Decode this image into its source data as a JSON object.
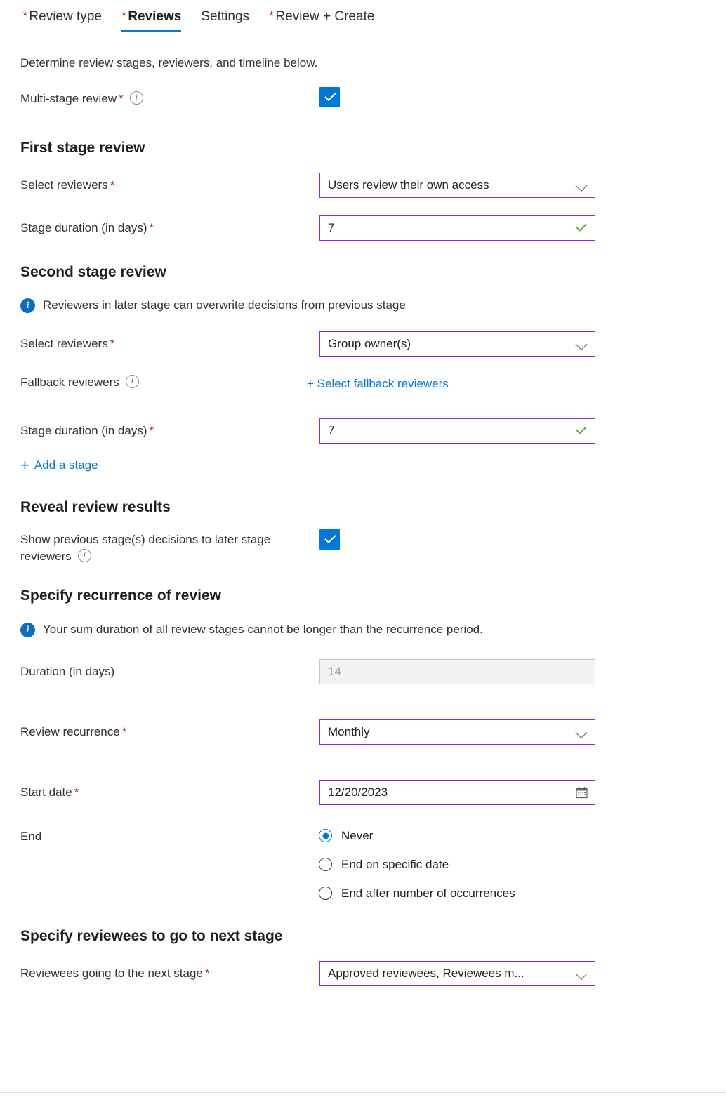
{
  "tabs": [
    {
      "label": "Review type",
      "required": true,
      "active": false
    },
    {
      "label": "Reviews",
      "required": true,
      "active": true
    },
    {
      "label": "Settings",
      "required": false,
      "active": false
    },
    {
      "label": "Review + Create",
      "required": true,
      "active": false
    }
  ],
  "intro": "Determine review stages, reviewers, and timeline below.",
  "multi_stage": {
    "label": "Multi-stage review",
    "required_mark": "*",
    "info_icon": "info-circle-outline-icon",
    "checked": true
  },
  "first_stage": {
    "heading": "First stage review",
    "select_reviewers": {
      "label": "Select reviewers",
      "required_mark": "*",
      "value": "Users review their own access",
      "icon": "chevron-down-icon"
    },
    "stage_duration": {
      "label": "Stage duration (in days)",
      "required_mark": "*",
      "value": "7",
      "icon": "green-check-icon"
    }
  },
  "second_stage": {
    "heading": "Second stage review",
    "info_message": "Reviewers in later stage can overwrite decisions from previous stage",
    "info_icon": "info-circle-filled-icon",
    "select_reviewers": {
      "label": "Select reviewers",
      "required_mark": "*",
      "value": "Group owner(s)",
      "icon": "chevron-down-icon"
    },
    "fallback_reviewers": {
      "label": "Fallback reviewers",
      "info_icon": "info-circle-outline-icon",
      "link_text": "+ Select fallback reviewers"
    },
    "stage_duration": {
      "label": "Stage duration (in days)",
      "required_mark": "*",
      "value": "7",
      "icon": "green-check-icon"
    },
    "add_stage_label": "Add a stage",
    "add_stage_icon": "plus-icon"
  },
  "reveal_results": {
    "heading": "Reveal review results",
    "label": "Show previous stage(s) decisions to later stage reviewers",
    "info_icon": "info-circle-outline-icon",
    "checked": true
  },
  "recurrence": {
    "heading": "Specify recurrence of review",
    "info_message": "Your sum duration of all review stages cannot be longer than the recurrence period.",
    "info_icon": "info-circle-filled-icon",
    "duration": {
      "label": "Duration (in days)",
      "value": "14",
      "disabled": true
    },
    "review_recurrence": {
      "label": "Review recurrence",
      "required_mark": "*",
      "value": "Monthly",
      "icon": "chevron-down-icon"
    },
    "start_date": {
      "label": "Start date",
      "required_mark": "*",
      "value": "12/20/2023",
      "icon": "calendar-icon"
    },
    "end": {
      "label": "End",
      "options": [
        {
          "label": "Never",
          "selected": true
        },
        {
          "label": "End on specific date",
          "selected": false
        },
        {
          "label": "End after number of occurrences",
          "selected": false
        }
      ]
    }
  },
  "next_stage": {
    "heading": "Specify reviewees to go to next stage",
    "reviewees": {
      "label": "Reviewees going to the next stage",
      "required_mark": "*",
      "value": "Approved reviewees, Reviewees m...",
      "icon": "chevron-down-icon"
    }
  },
  "colors": {
    "accent_blue": "#0078d4",
    "field_border_purple": "#8a2be2",
    "required_red": "#a4262c",
    "valid_green": "#5ba82e",
    "disabled_bg": "#f3f2f1"
  }
}
